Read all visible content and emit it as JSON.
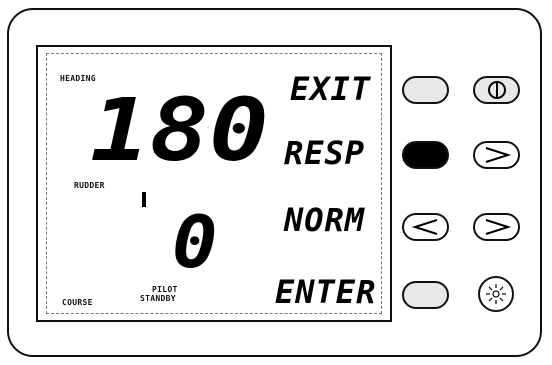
{
  "display": {
    "heading_label": "HEADING",
    "heading_value": "180",
    "rudder_label": "RUDDER",
    "course_value": "0",
    "course_label": "COURSE",
    "pilot_label": "PILOT",
    "standby_label": "STANDBY"
  },
  "softkeys": {
    "exit": "EXIT",
    "resp": "RESP",
    "norm": "NORM",
    "enter": "ENTER"
  },
  "icons": {
    "power": "power-icon",
    "right_arrow": "chevron-right-icon",
    "left_arrow": "chevron-left-icon",
    "light": "sun-icon"
  }
}
